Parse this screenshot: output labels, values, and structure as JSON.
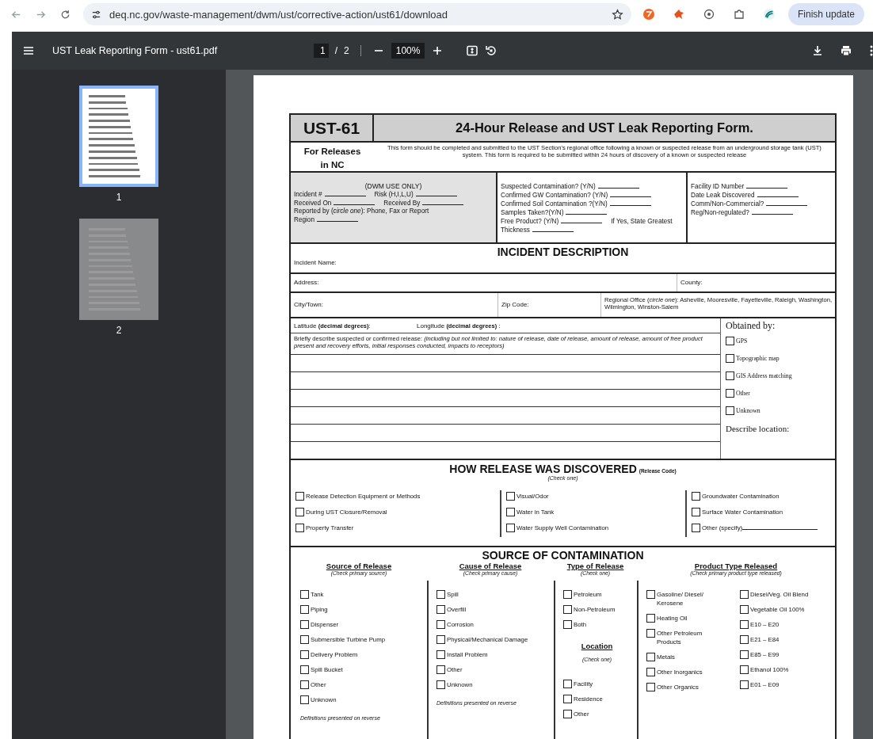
{
  "browser": {
    "url": "deq.nc.gov/waste-management/dwm/ust/corrective-action/ust61/download",
    "update_button": "Finish update"
  },
  "viewer": {
    "title": "UST Leak Reporting Form - ust61.pdf",
    "page": "1",
    "page_separator": "/",
    "page_total": "2",
    "zoom": "100%",
    "thumbnails": [
      {
        "label": "1",
        "selected": true
      },
      {
        "label": "2",
        "selected": false
      }
    ]
  },
  "form": {
    "code": "UST-61",
    "title": "24-Hour Release and UST Leak Reporting Form.",
    "scope": "For Releases in NC",
    "intro": "This form should be completed and submitted to the UST Section's regional office following a known or suspected release from an underground storage tank (UST) system.  This form is required to be submitted within 24 hours of discovery of a known or suspected release",
    "dwm": {
      "heading": "(DWM USE ONLY)",
      "rows": [
        [
          {
            "kind": "field",
            "label": "Incident #"
          },
          {
            "kind": "field",
            "label": "Risk (H,I,L,U)"
          }
        ],
        [
          {
            "kind": "field",
            "label": "Received On"
          },
          {
            "kind": "field",
            "label": "Received By"
          }
        ],
        [
          {
            "kind": "text",
            "label": "Reported by  (*circle one*): Phone, Fax or Report"
          }
        ],
        [
          {
            "kind": "field",
            "label": "Region"
          }
        ]
      ]
    },
    "contamination": {
      "rows": [
        [
          {
            "kind": "field",
            "label": "Suspected Contamination?  (Y/N)"
          }
        ],
        [
          {
            "kind": "field",
            "label": "Confirmed GW Contamination? (Y/N)"
          }
        ],
        [
          {
            "kind": "field",
            "label": "Confirmed Soil Contamination ?(Y/N)"
          }
        ],
        [
          {
            "kind": "field",
            "label": "Samples Taken?(Y/N)"
          }
        ],
        [
          {
            "kind": "field",
            "label": "Free Product? (Y/N)"
          },
          {
            "kind": "text",
            "label": "If Yes, State Greatest"
          }
        ],
        [
          {
            "kind": "field",
            "label": "Thickness"
          }
        ]
      ]
    },
    "facility": {
      "rows": [
        [
          {
            "kind": "field",
            "label": "Facility ID Number"
          }
        ],
        [
          {
            "kind": "field",
            "label": "Date Leak Discovered"
          }
        ],
        [
          {
            "kind": "field",
            "label": "Comm/Non-Commercial?"
          }
        ],
        [
          {
            "kind": "field",
            "label": "Reg/Non-regulated?"
          }
        ]
      ]
    },
    "incident": {
      "heading": "INCIDENT DESCRIPTION",
      "name_label": "Incident Name:",
      "address_label": "Address:",
      "county_label": "County:",
      "city_label": "City/Town:",
      "zip_label": "Zip Code:",
      "regional_office": "Regional Office (*circle one*):  Asheville, Mooresville, Fayetteville, Raleigh, Washington, Wilmington, Winston-Salem",
      "latitude": {
        "label": "Latitude",
        "unit": "(decimal degrees)",
        "suffix": ":"
      },
      "longitude": {
        "label": "Longitude",
        "unit": "(decimal degrees)",
        "suffix": " :"
      },
      "describe": "Briefly describe suspected or confirmed release: *(including but not limited to: nature of release, date of release, amount of release, amount of  free product present and recovery efforts, initial responses conducted, impacts to receptors)*",
      "obtained": {
        "heading": "Obtained by:",
        "options": [
          {
            "label": "GPS",
            "checked": false
          },
          {
            "label": "Topographic map",
            "checked": false
          },
          {
            "label": "GIS Address matching",
            "checked": false
          },
          {
            "label": "Other",
            "checked": false
          },
          {
            "label": "Unknown",
            "checked": false
          }
        ],
        "describe_label": "Describe location:"
      }
    },
    "discovered": {
      "heading": "HOW RELEASE WAS DISCOVERED",
      "note": "(Release Code)",
      "instruction": "(Check one)",
      "columns": [
        [
          {
            "kind": "option",
            "label": "Release Detection Equipment or Methods",
            "checked": false
          },
          {
            "kind": "option",
            "label": "During UST Closure/Removal",
            "checked": false
          },
          {
            "kind": "option",
            "label": "Property Transfer",
            "checked": false
          }
        ],
        [
          {
            "kind": "option",
            "label": "Visual/Odor",
            "checked": false
          },
          {
            "kind": "option",
            "label": "Water in Tank",
            "checked": false
          },
          {
            "kind": "option",
            "label": "Water Supply Well Contamination",
            "checked": false
          }
        ],
        [
          {
            "kind": "option",
            "label": "Groundwater Contamination",
            "checked": false
          },
          {
            "kind": "option",
            "label": "Surface Water Contamination",
            "checked": false
          },
          {
            "kind": "specify",
            "label": "Other (specify)",
            "checked": false
          }
        ]
      ]
    },
    "source": {
      "heading": "SOURCE OF CONTAMINATION",
      "groups": [
        {
          "kind": "list",
          "title": "Source of Release",
          "instruction": "(Check primary source)",
          "options": [
            {
              "label": "Tank",
              "checked": false
            },
            {
              "label": "Piping",
              "checked": false
            },
            {
              "label": "Dispenser",
              "checked": false
            },
            {
              "label": "Submersible Turbine Pump",
              "checked": false
            },
            {
              "label": "Delivery Problem",
              "checked": false
            },
            {
              "label": "Spill Bucket",
              "checked": false
            },
            {
              "label": "Other",
              "checked": false
            },
            {
              "label": "Unknown",
              "checked": false
            }
          ],
          "footnote": "Definitions presented on reverse"
        },
        {
          "kind": "list",
          "title": "Cause of Release",
          "instruction": "(Check primary cause)",
          "options": [
            {
              "label": "Spill",
              "checked": false
            },
            {
              "label": "Overfill",
              "checked": false
            },
            {
              "label": "Corrosion",
              "checked": false
            },
            {
              "label": "Physical/Mechanical Damage",
              "checked": false
            },
            {
              "label": "Install Problem",
              "checked": false
            },
            {
              "label": "Other",
              "checked": false
            },
            {
              "label": "Unknown",
              "checked": false
            }
          ],
          "footnote": "Definitions presented on reverse"
        },
        {
          "kind": "with_location",
          "title": "Type of Release",
          "instruction": "(Check one)",
          "options": [
            {
              "label": "Petroleum",
              "checked": false
            },
            {
              "label": "Non-Petroleum",
              "checked": false
            },
            {
              "label": "Both",
              "checked": false
            }
          ],
          "location": {
            "title": "Location",
            "instruction": "(Check one)",
            "options": [
              {
                "label": "Facility",
                "checked": false
              },
              {
                "label": "Residence",
                "checked": false
              },
              {
                "label": "Other",
                "checked": false
              }
            ]
          }
        },
        {
          "kind": "two_column",
          "title": "Product Type Released",
          "instruction": "(Check primary product type released)",
          "option_columns": [
            [
              {
                "label": "Gasoline/ Diesel/ Kerosene",
                "checked": false
              },
              {
                "label": "Heating  Oil",
                "checked": false
              },
              {
                "label": "Other Petroleum Products",
                "checked": false
              },
              {
                "label": "Metals",
                "checked": false
              },
              {
                "label": "Other Inorganics",
                "checked": false
              },
              {
                "label": "Other Organics",
                "checked": false
              }
            ],
            [
              {
                "label": "Diesel/Veg. Oil Blend",
                "checked": false
              },
              {
                "label": "Vegetable Oil 100%",
                "checked": false
              },
              {
                "label": "E10 – E20",
                "checked": false
              },
              {
                "label": "E21 – E84",
                "checked": false
              },
              {
                "label": "E85 – E99",
                "checked": false
              },
              {
                "label": "Ethanol 100%",
                "checked": false
              },
              {
                "label": "E01 – E09",
                "checked": false
              }
            ]
          ]
        }
      ]
    }
  }
}
